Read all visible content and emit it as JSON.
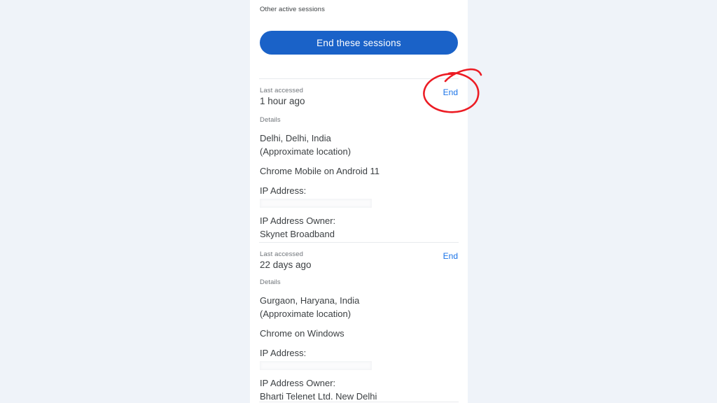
{
  "page": {
    "background_color": "#eff3f9",
    "card_background": "#ffffff"
  },
  "section": {
    "heading": "Other active sessions"
  },
  "primary_action": {
    "label": "End these sessions",
    "color": "#1a62c8",
    "text_color": "#ffffff"
  },
  "labels": {
    "last_accessed": "Last accessed",
    "details": "Details",
    "end": "End",
    "ip_address": "IP Address:",
    "ip_address_owner": "IP Address Owner:",
    "approximate_location": "(Approximate location)"
  },
  "link_color": "#1a73e8",
  "sessions": [
    {
      "last_accessed_label": "Last accessed",
      "last_accessed_value": "1 hour ago",
      "end_label": "End",
      "details_label": "Details",
      "location": "Delhi, Delhi, India",
      "location_note": "(Approximate location)",
      "device": "Chrome Mobile on Android 11",
      "ip_label": "IP Address:",
      "ip_value": "",
      "ip_redacted": true,
      "ip_owner_label": "IP Address Owner:",
      "ip_owner_value": "Skynet Broadband"
    },
    {
      "last_accessed_label": "Last accessed",
      "last_accessed_value": "22 days ago",
      "end_label": "End",
      "details_label": "Details",
      "location": "Gurgaon, Haryana, India",
      "location_note": "(Approximate location)",
      "device": "Chrome on Windows",
      "ip_label": "IP Address:",
      "ip_value": "",
      "ip_redacted": true,
      "ip_owner_label": "IP Address Owner:",
      "ip_owner_value": "Bharti Telenet Ltd. New Delhi"
    }
  ],
  "annotation": {
    "type": "hand-drawn-circle",
    "color": "#ec1c24",
    "targets": "end-link-session-1"
  }
}
